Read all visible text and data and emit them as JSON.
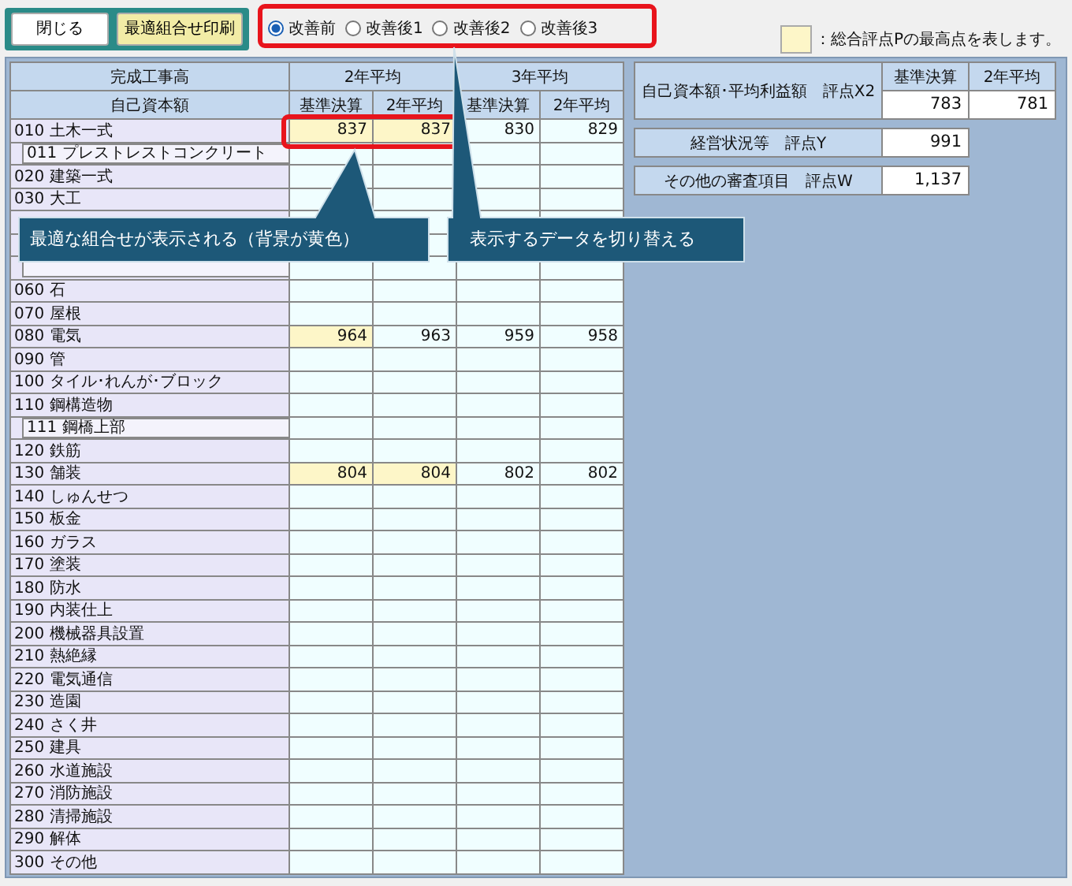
{
  "toolbar": {
    "buttons": [
      {
        "label": "閉じる",
        "kind": "plain"
      },
      {
        "label": "最適組合せ印刷",
        "kind": "accent"
      }
    ],
    "radios": [
      {
        "label": "改善前",
        "selected": true
      },
      {
        "label": "改善後1",
        "selected": false
      },
      {
        "label": "改善後2",
        "selected": false
      },
      {
        "label": "改善後3",
        "selected": false
      }
    ],
    "legend": "：総合評点Pの最高点を表します。"
  },
  "table": {
    "header_top": [
      "完成工事高",
      "2年平均",
      "3年平均"
    ],
    "header_sub": [
      "自己資本額",
      "基準決算",
      "2年平均",
      "基準決算",
      "2年平均"
    ],
    "rows": [
      {
        "label": "010 土木一式",
        "kind": "main",
        "cells": [
          {
            "text": "837",
            "highlighted": true
          },
          {
            "text": "837",
            "highlighted": true
          },
          {
            "text": "830",
            "highlighted": false
          },
          {
            "text": "829",
            "highlighted": false
          }
        ]
      },
      {
        "label": "011 プレストレストコンクリート",
        "kind": "sub"
      },
      {
        "label": "020 建築一式",
        "kind": "main"
      },
      {
        "label": "030 大工",
        "kind": "main"
      },
      {
        "kind": "main"
      },
      {
        "kind": "covered"
      },
      {
        "kind": "sub"
      },
      {
        "label": "060 石",
        "kind": "main"
      },
      {
        "label": "070 屋根",
        "kind": "main"
      },
      {
        "label": "080 電気",
        "kind": "main",
        "cells": [
          {
            "text": "964",
            "highlighted": true
          },
          {
            "text": "963",
            "highlighted": false
          },
          {
            "text": "959",
            "highlighted": false
          },
          {
            "text": "958",
            "highlighted": false
          }
        ]
      },
      {
        "label": "090 管",
        "kind": "main"
      },
      {
        "label": "100 タイル･れんが･ブロック",
        "kind": "main"
      },
      {
        "label": "110 鋼構造物",
        "kind": "main"
      },
      {
        "label": "111 鋼橋上部",
        "kind": "sub"
      },
      {
        "label": "120 鉄筋",
        "kind": "main"
      },
      {
        "label": "130 舗装",
        "kind": "main",
        "cells": [
          {
            "text": "804",
            "highlighted": true
          },
          {
            "text": "804",
            "highlighted": true
          },
          {
            "text": "802",
            "highlighted": false
          },
          {
            "text": "802",
            "highlighted": false
          }
        ]
      },
      {
        "label": "140 しゅんせつ",
        "kind": "main"
      },
      {
        "label": "150 板金",
        "kind": "main"
      },
      {
        "label": "160 ガラス",
        "kind": "main"
      },
      {
        "label": "170 塗装",
        "kind": "main"
      },
      {
        "label": "180 防水",
        "kind": "main"
      },
      {
        "label": "190 内装仕上",
        "kind": "main"
      },
      {
        "label": "200 機械器具設置",
        "kind": "main"
      },
      {
        "label": "210 熱絶縁",
        "kind": "main"
      },
      {
        "label": "220 電気通信",
        "kind": "main"
      },
      {
        "label": "230 造園",
        "kind": "main"
      },
      {
        "label": "240 さく井",
        "kind": "main"
      },
      {
        "label": "250 建具",
        "kind": "main"
      },
      {
        "label": "260 水道施設",
        "kind": "main"
      },
      {
        "label": "270 消防施設",
        "kind": "main"
      },
      {
        "label": "280 清掃施設",
        "kind": "main"
      },
      {
        "label": "290 解体",
        "kind": "main"
      },
      {
        "label": "300 その他",
        "kind": "main"
      }
    ]
  },
  "scores": {
    "x2": {
      "label": "自己資本額･平均利益額　評点X2",
      "headers": [
        "基準決算",
        "2年平均"
      ],
      "values": [
        "783",
        "781"
      ]
    },
    "others": [
      {
        "label": "経営状況等　評点Y",
        "value": "991"
      },
      {
        "label": "その他の審査項目　評点W",
        "value": "1,137"
      }
    ]
  },
  "callouts": [
    {
      "text": "最適な組合せが表示される（背景が黄色）"
    },
    {
      "text": "表示するデータを切り替える"
    }
  ]
}
